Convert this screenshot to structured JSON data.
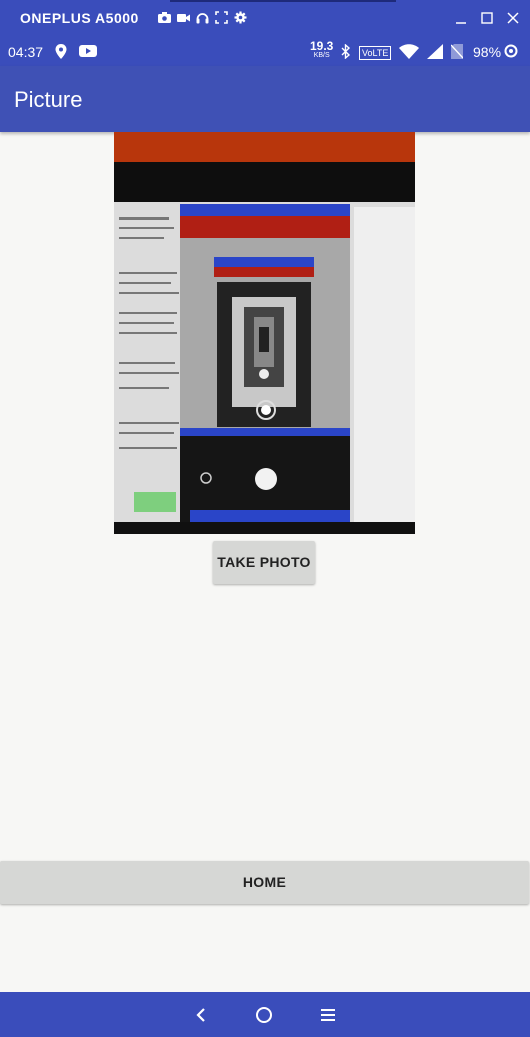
{
  "window": {
    "title": "ONEPLUS A5000",
    "toolbar_icons": [
      "camera-icon",
      "video-icon",
      "headphones-icon",
      "fullscreen-icon",
      "gear-icon"
    ],
    "controls": [
      "minimize-icon",
      "maximize-icon",
      "close-icon"
    ]
  },
  "status_bar": {
    "time": "04:37",
    "left_icons": [
      "location-icon",
      "youtube-icon"
    ],
    "speed_value": "19.3",
    "speed_unit": "KB/S",
    "volte": "VoLTE",
    "right_icons": [
      "bluetooth-icon",
      "volte-icon",
      "wifi-icon",
      "signal-icon",
      "no-sim-icon"
    ],
    "battery": "98%"
  },
  "app_bar": {
    "title": "Picture"
  },
  "photo": {
    "description_icon": "captured-photo"
  },
  "buttons": {
    "take_photo": "TAKE PHOTO",
    "home": "HOME"
  },
  "nav_bar": {
    "items": [
      "back-icon",
      "home-circle-icon",
      "menu-icon"
    ]
  },
  "colors": {
    "primary": "#3f51b5",
    "status": "#3a4dbb",
    "background": "#f7f7f5",
    "button": "#d6d7d5"
  }
}
